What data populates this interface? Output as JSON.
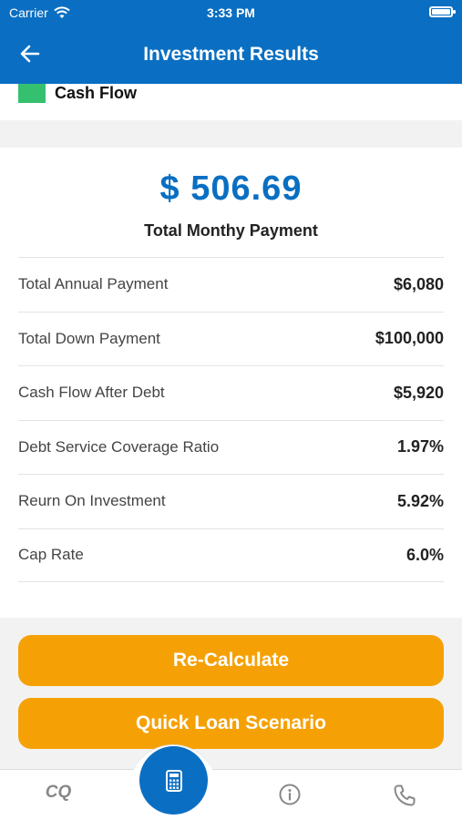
{
  "status": {
    "carrier": "Carrier",
    "time": "3:33 PM"
  },
  "header": {
    "title": "Investment Results"
  },
  "legend": {
    "label": "Cash Flow",
    "color": "#35c06f"
  },
  "summary": {
    "amount": "$ 506.69",
    "caption": "Total Monthy Payment"
  },
  "rows": [
    {
      "label": "Total Annual Payment",
      "value": "$6,080"
    },
    {
      "label": "Total Down Payment",
      "value": "$100,000"
    },
    {
      "label": "Cash Flow After Debt",
      "value": "$5,920"
    },
    {
      "label": "Debt Service Coverage Ratio",
      "value": "1.97%"
    },
    {
      "label": "Reurn On Investment",
      "value": "5.92%"
    },
    {
      "label": "Cap Rate",
      "value": "6.0%"
    }
  ],
  "actions": {
    "recalculate": "Re-Calculate",
    "quick_loan": "Quick Loan Scenario"
  },
  "tabbar": {
    "cq": "CQ",
    "icons": [
      "calculator-icon",
      "info-icon",
      "phone-icon"
    ]
  },
  "colors": {
    "primary": "#0a6fc2",
    "accent": "#f5a105"
  }
}
